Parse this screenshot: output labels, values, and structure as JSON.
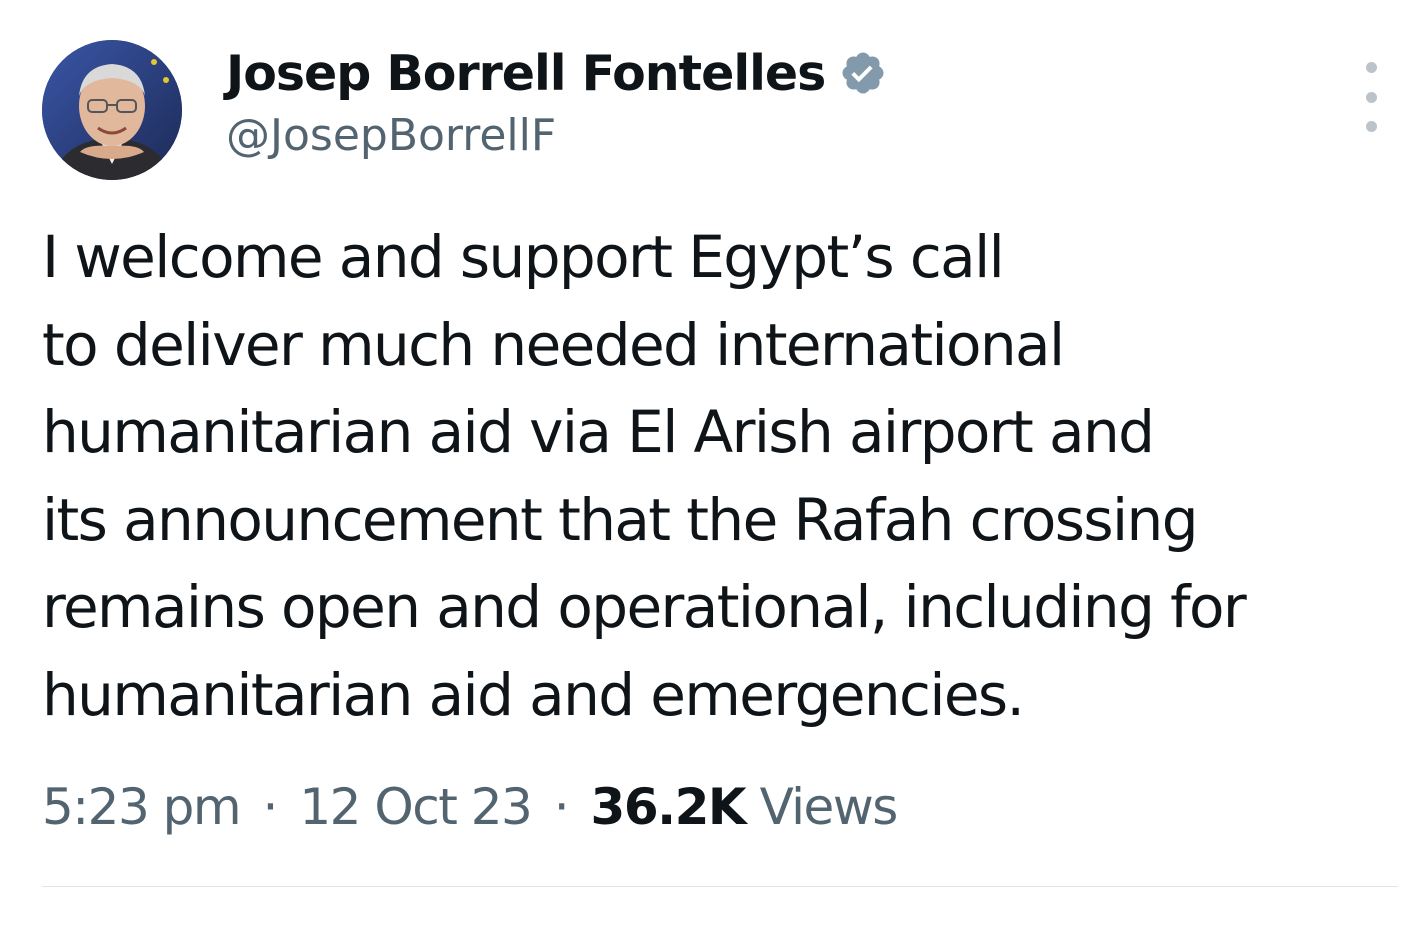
{
  "author": {
    "display_name": "Josep Borrell Fontelles",
    "handle": "@JosepBorrellF",
    "verified_icon": "verified-badge-icon",
    "verified_color": "#829aab"
  },
  "tweet": {
    "lines": [
      "I welcome and support Egypt’s call",
      "to deliver much needed international",
      "humanitarian aid via El Arish airport and",
      "its announcement that the Rafah crossing",
      "remains open and operational, including for",
      "humanitarian aid and emergencies."
    ]
  },
  "meta": {
    "time": "5:23 pm",
    "separator": "·",
    "date": "12 Oct 23",
    "views_count": "36.2K",
    "views_label": "Views"
  },
  "menu": {
    "icon": "more-options-icon"
  }
}
